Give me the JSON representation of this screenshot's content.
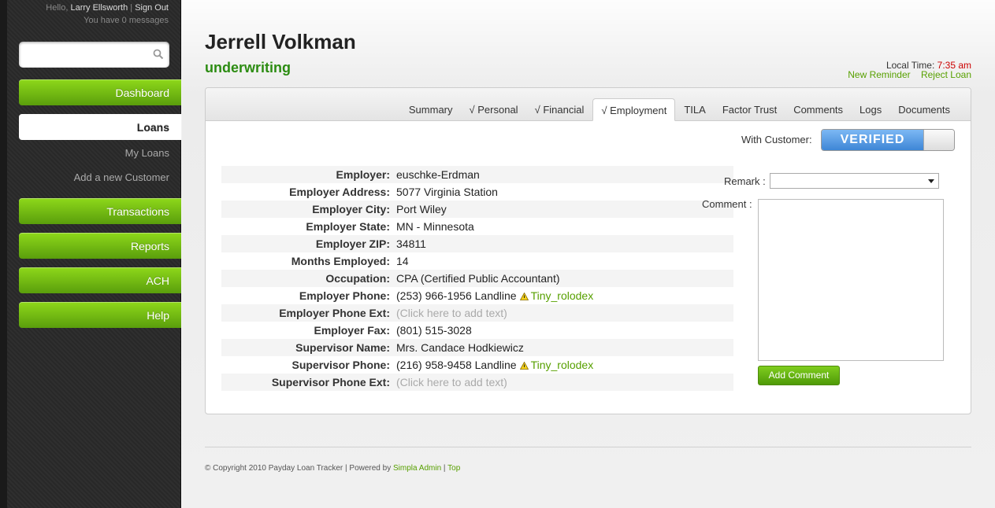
{
  "profile": {
    "greeting": "Hello,",
    "user": "Larry Ellsworth",
    "separator": "|",
    "sign_out": "Sign Out",
    "messages": "You have 0 messages"
  },
  "search": {
    "placeholder": ""
  },
  "nav": {
    "dashboard": "Dashboard",
    "loans": "Loans",
    "my_loans": "My Loans",
    "add_customer": "Add a new Customer",
    "transactions": "Transactions",
    "reports": "Reports",
    "ach": "ACH",
    "help": "Help"
  },
  "header": {
    "name": "Jerrell Volkman",
    "status": "underwriting",
    "local_time_label": "Local Time:",
    "local_time": "7:35 am",
    "new_reminder": "New Reminder",
    "reject_loan": "Reject Loan"
  },
  "tabs": [
    {
      "label": "Summary"
    },
    {
      "label": "√ Personal"
    },
    {
      "label": "√ Financial"
    },
    {
      "label": "√ Employment"
    },
    {
      "label": "TILA"
    },
    {
      "label": "Factor Trust"
    },
    {
      "label": "Comments"
    },
    {
      "label": "Logs"
    },
    {
      "label": "Documents"
    }
  ],
  "active_tab": "√ Employment",
  "with_customer": {
    "label": "With Customer:",
    "state": "VERIFIED"
  },
  "fields": [
    {
      "label": "Employer:",
      "value": "euschke-Erdman"
    },
    {
      "label": "Employer Address:",
      "value": "5077 Virginia Station"
    },
    {
      "label": "Employer City:",
      "value": "Port Wiley"
    },
    {
      "label": "Employer State:",
      "value": "MN - Minnesota"
    },
    {
      "label": "Employer ZIP:",
      "value": "34811"
    },
    {
      "label": "Months Employed:",
      "value": "14"
    },
    {
      "label": "Occupation:",
      "value": "CPA (Certified Public Accountant)"
    },
    {
      "label": "Employer Phone:",
      "value": "(253) 966-1956 Landline",
      "link": "Tiny_rolodex"
    },
    {
      "label": "Employer Phone Ext:",
      "value": "(Click here to add text)",
      "placeholder": true
    },
    {
      "label": "Employer Fax:",
      "value": "(801) 515-3028"
    },
    {
      "label": "Supervisor Name:",
      "value": "Mrs. Candace Hodkiewicz"
    },
    {
      "label": "Supervisor Phone:",
      "value": "(216) 958-9458 Landline",
      "link": "Tiny_rolodex"
    },
    {
      "label": "Supervisor Phone Ext:",
      "value": "(Click here to add text)",
      "placeholder": true
    }
  ],
  "remark": {
    "label": "Remark :",
    "value": ""
  },
  "comment": {
    "label": "Comment :",
    "value": "",
    "button": "Add Comment"
  },
  "footer": {
    "copyright": "© Copyright 2010 Payday Loan Tracker | Powered by",
    "simpla": "Simpla Admin",
    "sep": "|",
    "top": "Top"
  },
  "colors": {
    "accent_green": "#57a000",
    "status_green": "#2c8c12",
    "time_red": "#cc0000",
    "verified_blue": "#3e86d6"
  }
}
